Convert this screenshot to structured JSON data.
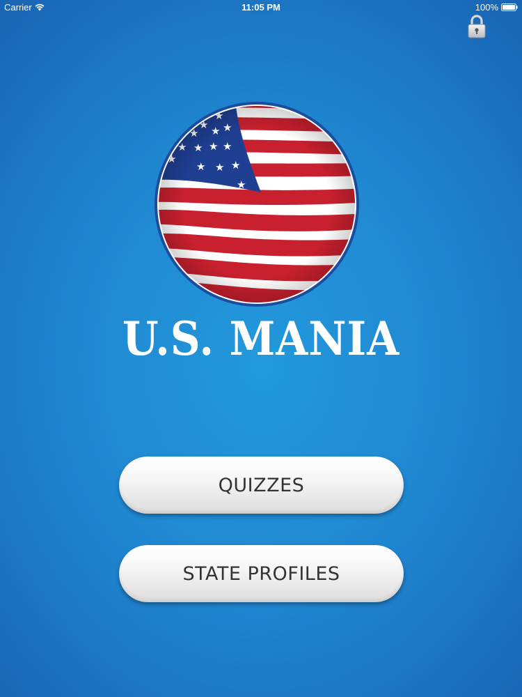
{
  "status_bar": {
    "carrier": "Carrier",
    "time": "11:05 PM",
    "battery": "100%"
  },
  "header": {
    "lock_icon": "padlock-icon"
  },
  "logo": {
    "icon": "us-flag-circle-icon",
    "colors": {
      "red": "#c8202e",
      "blue": "#1f3f93",
      "white": "#ffffff"
    }
  },
  "app_title": "U.S. MANIA",
  "menu": {
    "quizzes_label": "QUIZZES",
    "state_profiles_label": "STATE PROFILES"
  },
  "colors": {
    "background": "#1f86d0",
    "button": "#f2f2f2",
    "button_text": "#333333"
  }
}
